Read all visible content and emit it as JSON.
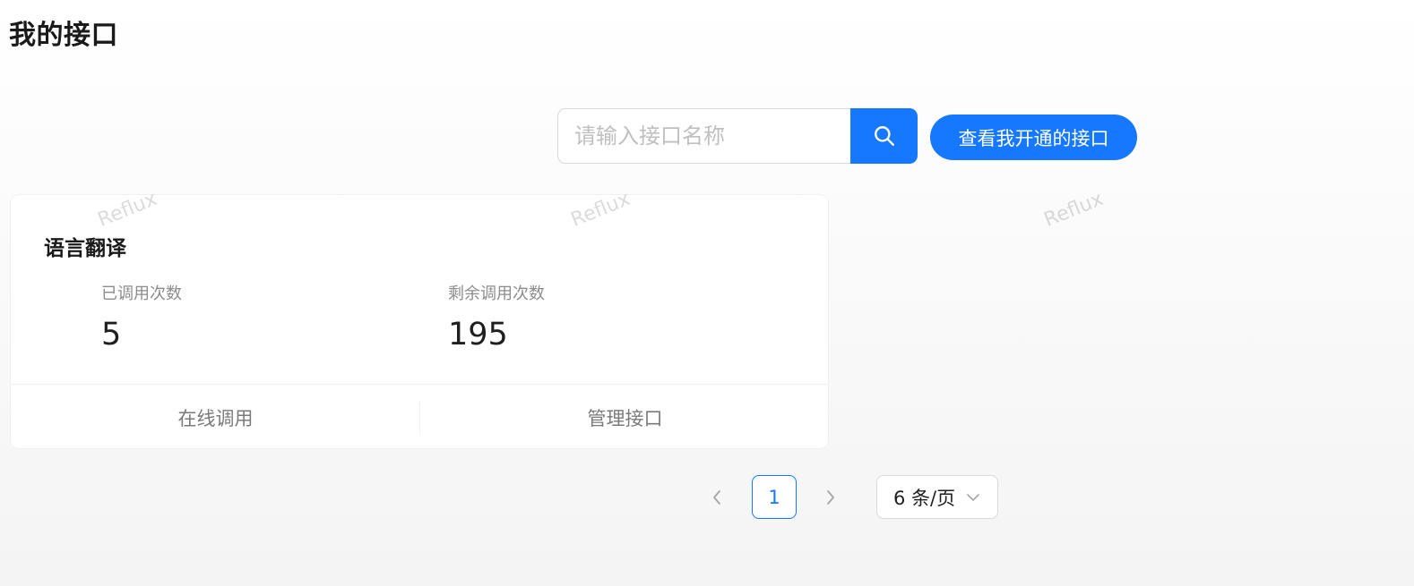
{
  "page": {
    "title": "我的接口"
  },
  "search": {
    "placeholder": "请输入接口名称",
    "value": "",
    "button_icon": "search-icon"
  },
  "toolbar": {
    "my_apis_label": "查看我开通的接口"
  },
  "watermark": {
    "text": "Reflux"
  },
  "cards": [
    {
      "title": "语言翻译",
      "stats": [
        {
          "label": "已调用次数",
          "value": "5"
        },
        {
          "label": "剩余调用次数",
          "value": "195"
        }
      ],
      "actions": [
        {
          "label": "在线调用"
        },
        {
          "label": "管理接口"
        }
      ]
    }
  ],
  "pagination": {
    "current_page": "1",
    "page_size_label": "6 条/页",
    "prev_icon": "chevron-left-icon",
    "next_icon": "chevron-right-icon"
  },
  "colors": {
    "primary": "#1677ff",
    "text": "#1f1f1f",
    "muted": "#8c8c8c"
  }
}
